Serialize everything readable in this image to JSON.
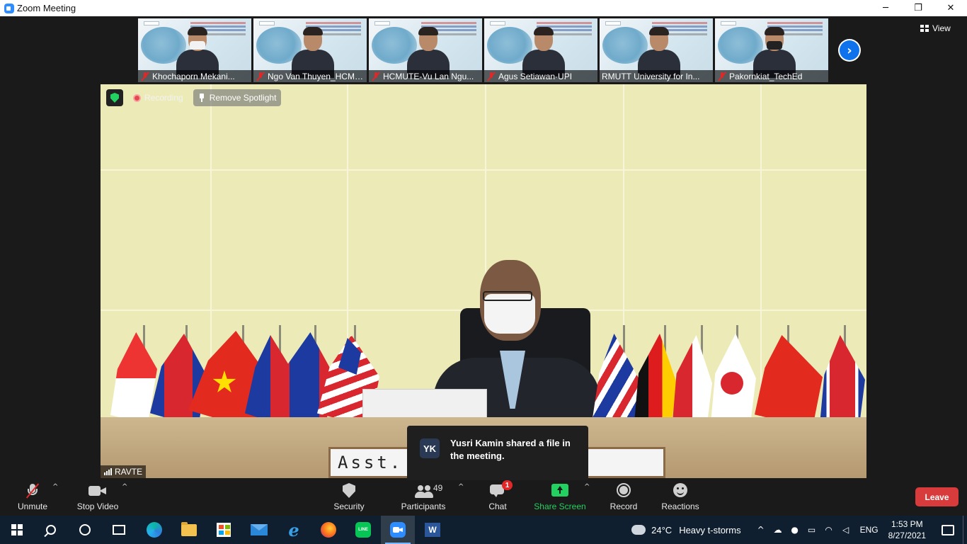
{
  "window": {
    "title": "Zoom Meeting",
    "minimize": "─",
    "maximize": "❐",
    "close": "✕"
  },
  "thumbnails": [
    {
      "name": "Khochaporn Mekani...",
      "mask": "white"
    },
    {
      "name": "Ngo Van Thuyen_HCMUTE",
      "mask": "none"
    },
    {
      "name": "HCMUTE-Vu Lan Ngu...",
      "mask": "none"
    },
    {
      "name": "Agus Setiawan-UPI",
      "mask": "none"
    },
    {
      "name": "RMUTT University for In...",
      "mask": "none"
    },
    {
      "name": "Pakornkiat_TechEd",
      "mask": "black"
    }
  ],
  "next_page": "›",
  "view": {
    "label": "View"
  },
  "main_video": {
    "recording": "Recording",
    "remove_spotlight": "Remove Spotlight",
    "label": "RAVTE",
    "nameplate": "Asst.         omphol"
  },
  "toast": {
    "initials": "YK",
    "message": "Yusri Kamin shared a file in the meeting."
  },
  "controls": {
    "unmute": "Unmute",
    "stop_video": "Stop Video",
    "security": "Security",
    "participants": "Participants",
    "participants_count": "49",
    "chat": "Chat",
    "chat_badge": "1",
    "share_screen": "Share Screen",
    "record": "Record",
    "reactions": "Reactions",
    "leave": "Leave",
    "caret": "^"
  },
  "taskbar": {
    "word": "W",
    "line": "LINE",
    "ie": "e",
    "weather_temp": "24°C",
    "weather_cond": "Heavy t-storms",
    "tray_chevron": "^",
    "language": "ENG",
    "time": "1:53 PM",
    "date": "8/27/2021"
  },
  "colors": {
    "accent": "#0E72ED",
    "share_green": "#23D160",
    "leave_red": "#D83B3B",
    "mic_off": "#E02828"
  }
}
